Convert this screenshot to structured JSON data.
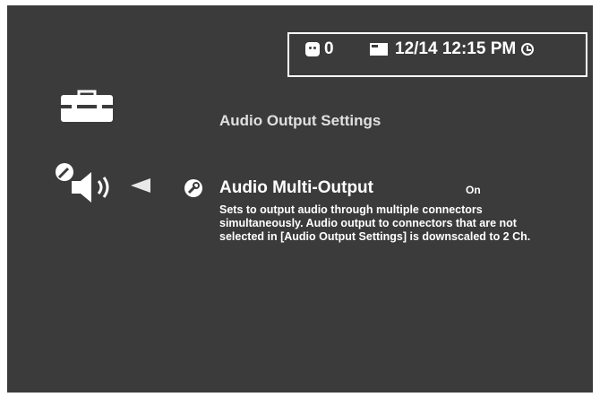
{
  "status_bar": {
    "message_count": "0",
    "datetime": "12/14 12:15 PM",
    "icons": [
      "message-icon",
      "card-icon",
      "clock-icon"
    ]
  },
  "section": {
    "icon": "toolbox-icon",
    "title": "Audio Output Settings"
  },
  "setting": {
    "category_icon": "speaker-wrench-icon",
    "label": "Audio Multi-Output",
    "value": "On",
    "description": "Sets to output audio through multiple connectors simultaneously. Audio output to connectors that are not selected in [Audio Output Settings] is downscaled to 2 Ch."
  },
  "colors": {
    "background": "#3b3b3b",
    "text": "#ffffff"
  }
}
